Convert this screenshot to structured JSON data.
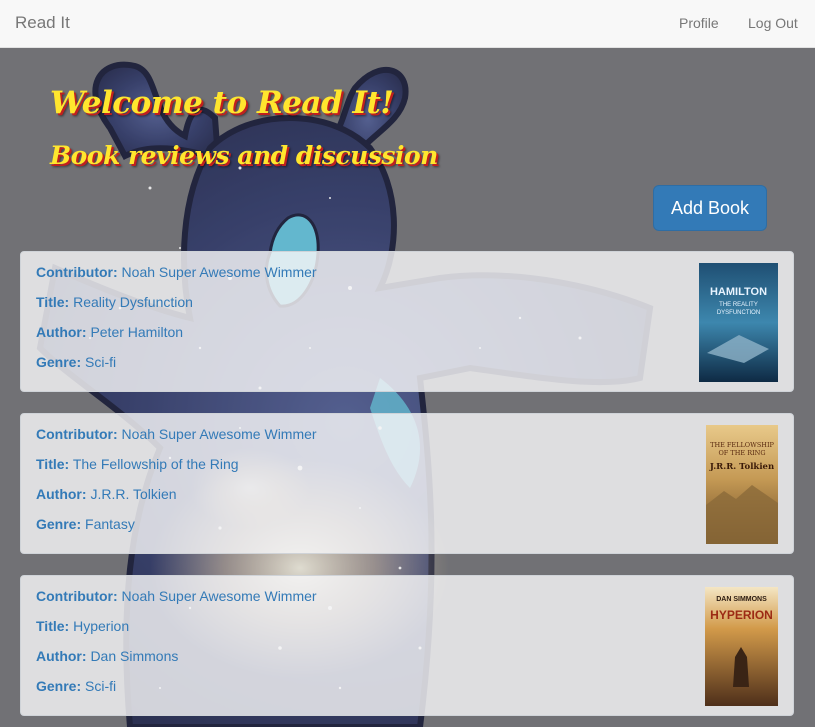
{
  "nav": {
    "brand": "Read It",
    "profile": "Profile",
    "logout": "Log Out"
  },
  "hero": {
    "title": "Welcome to Read It!",
    "subtitle": "Book reviews and discussion",
    "add_button": "Add Book"
  },
  "field_labels": {
    "contributor": "Contributor:",
    "title": "Title:",
    "author": "Author:",
    "genre": "Genre:"
  },
  "books": [
    {
      "contributor": "Noah Super Awesome Wimmer",
      "title": "Reality Dysfunction",
      "author": "Peter Hamilton",
      "genre": "Sci-fi",
      "cover_text": [
        "HAMILTON",
        "THE REALITY",
        "DYSFUNCTION"
      ]
    },
    {
      "contributor": "Noah Super Awesome Wimmer",
      "title": "The Fellowship of the Ring",
      "author": "J.R.R. Tolkien",
      "genre": "Fantasy",
      "cover_text": [
        "THE FELLOWSHIP",
        "OF THE RING",
        "J.R.R. Tolkien"
      ]
    },
    {
      "contributor": "Noah Super Awesome Wimmer",
      "title": "Hyperion",
      "author": "Dan Simmons",
      "genre": "Sci-fi",
      "cover_text": [
        "DAN SIMMONS",
        "HYPERION"
      ]
    }
  ],
  "colors": {
    "link": "#337ab7",
    "button": "#337ab7",
    "hero_text": "#ffe62e",
    "hero_shadow": "#c0201e"
  }
}
